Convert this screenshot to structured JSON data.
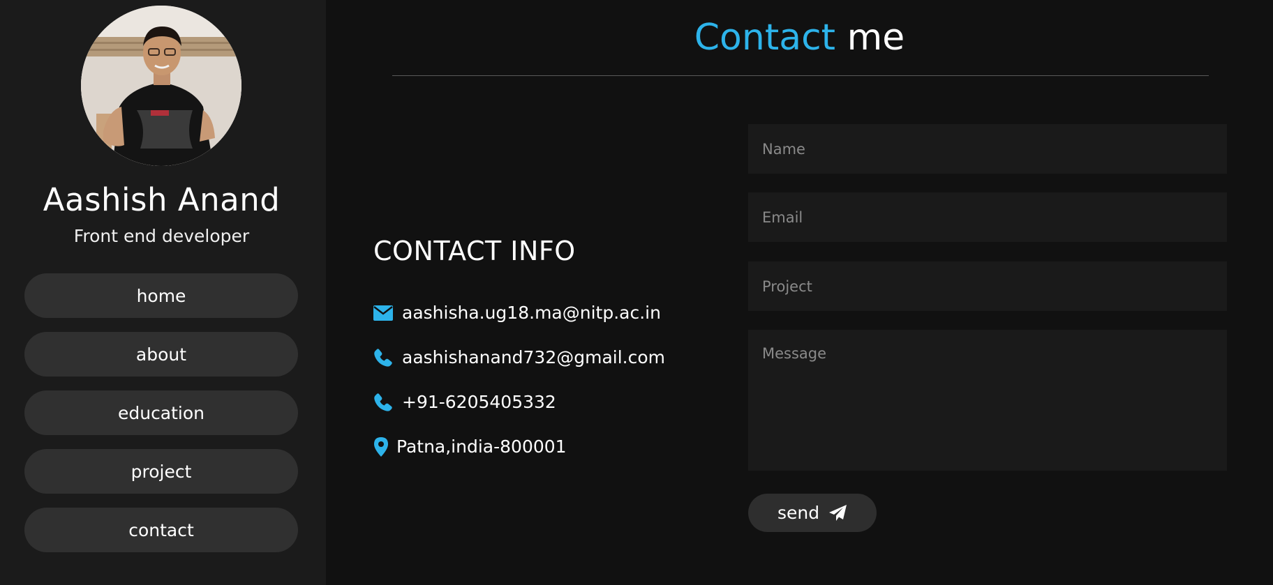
{
  "profile": {
    "name": "Aashish Anand",
    "role": "Front end developer"
  },
  "nav": {
    "items": [
      {
        "label": "home"
      },
      {
        "label": "about"
      },
      {
        "label": "education"
      },
      {
        "label": "project"
      },
      {
        "label": "contact"
      }
    ]
  },
  "page": {
    "title_accent": "Contact",
    "title_rest": " me"
  },
  "contact_info": {
    "heading": "CONTACT INFO",
    "items": [
      {
        "icon": "envelope-icon",
        "text": "aashisha.ug18.ma@nitp.ac.in"
      },
      {
        "icon": "phone-icon",
        "text": "aashishanand732@gmail.com"
      },
      {
        "icon": "phone-icon",
        "text": "+91-6205405332"
      },
      {
        "icon": "map-marker-icon",
        "text": "Patna,india-800001"
      }
    ]
  },
  "form": {
    "name_placeholder": "Name",
    "email_placeholder": "Email",
    "project_placeholder": "Project",
    "message_placeholder": "Message",
    "send_label": "send",
    "send_icon": "paper-plane-icon"
  },
  "colors": {
    "accent": "#2db3ea",
    "background": "#111111",
    "sidebar": "#1b1b1b",
    "pill": "#303030"
  }
}
